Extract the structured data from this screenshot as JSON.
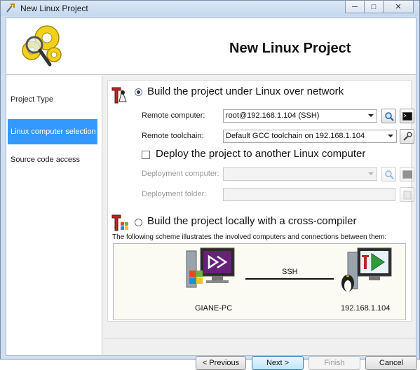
{
  "window": {
    "title": "New Linux Project",
    "controls": {
      "minimize": "─",
      "maximize": "□",
      "close": "✕"
    }
  },
  "header": {
    "title": "New Linux Project",
    "logo_icon": "gears-magnifier-icon"
  },
  "sidebar": {
    "items": [
      {
        "label": "Project Type",
        "active": false
      },
      {
        "label": "Linux computer selection",
        "active": true
      },
      {
        "label": "Source code access",
        "active": false
      }
    ]
  },
  "options": {
    "network_build": {
      "label": "Build the project under Linux over network",
      "selected": true
    },
    "remote_computer": {
      "label": "Remote computer:",
      "value": "root@192.168.1.104 (SSH)"
    },
    "remote_toolchain": {
      "label": "Remote toolchain:",
      "value": "Default GCC toolchain on 192.168.1.104"
    },
    "deploy": {
      "label": "Deploy the project to another Linux computer",
      "checked": false
    },
    "deployment_computer": {
      "label": "Deployment computer:",
      "value": ""
    },
    "deployment_folder": {
      "label": "Deployment folder:",
      "value": ""
    },
    "cross_build": {
      "label": "Build the project locally with a cross-compiler",
      "selected": false
    }
  },
  "scheme": {
    "caption": "The following scheme illustrates the involved computers and connections between them:",
    "local_name": "GIANE-PC",
    "connection": "SSH",
    "remote_name": "192.168.1.104"
  },
  "buttons": {
    "previous": "< Previous",
    "next": "Next >",
    "finish": "Finish",
    "cancel": "Cancel"
  },
  "colors": {
    "accent": "#3399ff",
    "window_frame": "#cfe0f3"
  }
}
